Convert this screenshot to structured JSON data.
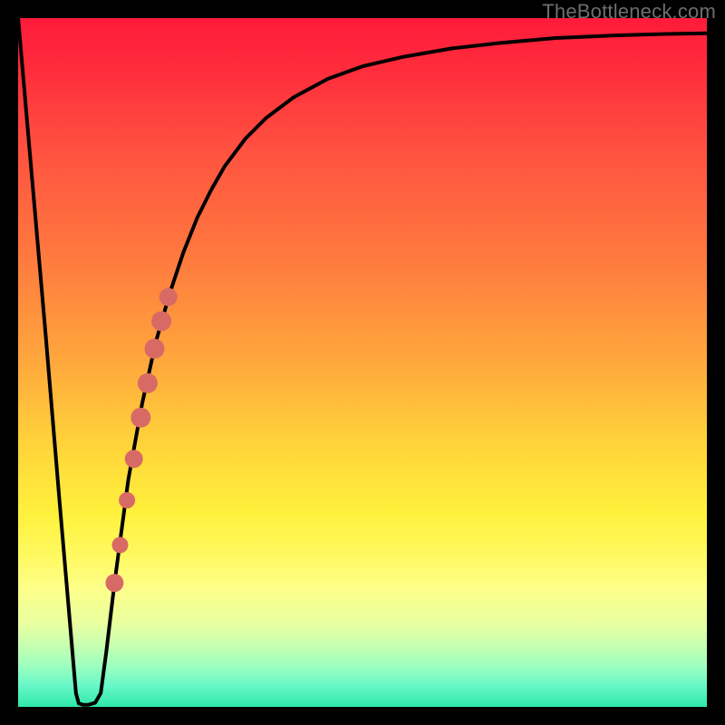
{
  "watermark": "TheBottleneck.com",
  "chart_data": {
    "type": "line",
    "title": "",
    "xlabel": "",
    "ylabel": "",
    "xlim": [
      0,
      1
    ],
    "ylim": [
      0,
      1
    ],
    "x": [
      0.0,
      0.02,
      0.04,
      0.06,
      0.084,
      0.088,
      0.094,
      0.102,
      0.112,
      0.12,
      0.128,
      0.14,
      0.16,
      0.18,
      0.2,
      0.22,
      0.24,
      0.26,
      0.28,
      0.3,
      0.33,
      0.36,
      0.4,
      0.45,
      0.5,
      0.56,
      0.63,
      0.7,
      0.78,
      0.87,
      0.94,
      1.0
    ],
    "values": [
      1.0,
      0.77,
      0.54,
      0.3,
      0.02,
      0.005,
      0.003,
      0.003,
      0.006,
      0.02,
      0.08,
      0.18,
      0.33,
      0.44,
      0.53,
      0.6,
      0.66,
      0.71,
      0.75,
      0.785,
      0.825,
      0.855,
      0.885,
      0.912,
      0.93,
      0.944,
      0.956,
      0.964,
      0.971,
      0.975,
      0.977,
      0.978
    ],
    "highlight_segment": {
      "type": "scatter",
      "color": "#d86a66",
      "points": [
        {
          "x": 0.14,
          "y": 0.18,
          "r": 10
        },
        {
          "x": 0.148,
          "y": 0.235,
          "r": 9
        },
        {
          "x": 0.158,
          "y": 0.3,
          "r": 9
        },
        {
          "x": 0.168,
          "y": 0.36,
          "r": 10
        },
        {
          "x": 0.178,
          "y": 0.42,
          "r": 11
        },
        {
          "x": 0.188,
          "y": 0.47,
          "r": 11
        },
        {
          "x": 0.198,
          "y": 0.52,
          "r": 11
        },
        {
          "x": 0.208,
          "y": 0.56,
          "r": 11
        },
        {
          "x": 0.218,
          "y": 0.595,
          "r": 10
        }
      ]
    }
  }
}
